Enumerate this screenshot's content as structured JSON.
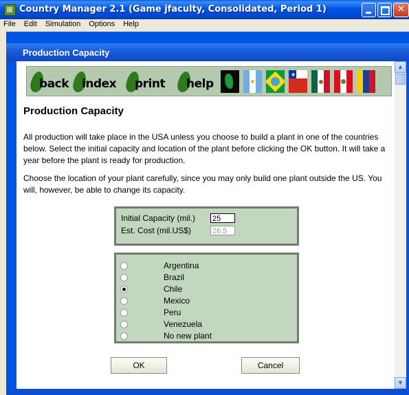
{
  "window": {
    "title": "Country Manager 2.1 (Game jfaculty, Consolidated, Period 1)"
  },
  "menu": [
    "File",
    "Edit",
    "Simulation",
    "Options",
    "Help"
  ],
  "inner_window": {
    "title": "Production Capacity"
  },
  "nav": {
    "back": "back",
    "index": "index",
    "print": "print",
    "help": "help"
  },
  "flags": [
    "Argentina",
    "Brazil",
    "Chile",
    "Mexico",
    "Peru",
    "Venezuela"
  ],
  "page": {
    "heading": "Production Capacity",
    "para1": "All production will take place in the USA unless you choose to build a plant in one of the countries below. Select the initial capacity and location of the plant before clicking the OK button. It will take a year before the plant is ready for production.",
    "para2": "Choose the location of your plant carefully, since you may only build one plant outside the US. You will, however, be able to change its capacity."
  },
  "capacity": {
    "label": "Initial Capacity (mil.)",
    "value": "25",
    "cost_label": "Est. Cost (mil.US$)",
    "cost_value": "26.5"
  },
  "countries": [
    {
      "name": "Argentina",
      "selected": false
    },
    {
      "name": "Brazil",
      "selected": false
    },
    {
      "name": "Chile",
      "selected": true
    },
    {
      "name": "Mexico",
      "selected": false
    },
    {
      "name": "Peru",
      "selected": false
    },
    {
      "name": "Venezuela",
      "selected": false
    },
    {
      "name": "No new plant",
      "selected": false
    }
  ],
  "buttons": {
    "ok": "OK",
    "cancel": "Cancel"
  }
}
